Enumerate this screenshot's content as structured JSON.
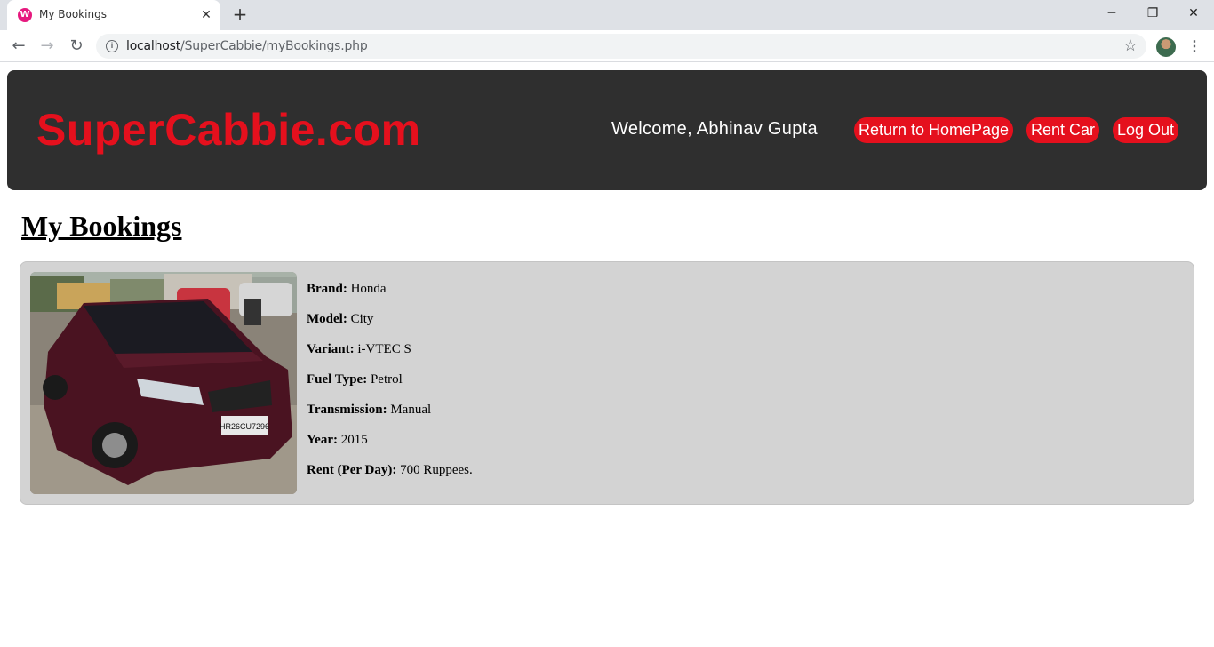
{
  "browser": {
    "tab_title": "My Bookings",
    "tab_favicon_letter": "W",
    "url_host": "localhost",
    "url_path": "/SuperCabbie/myBookings.php"
  },
  "header": {
    "logo": "SuperCabbie.com",
    "welcome": "Welcome, Abhinav Gupta",
    "nav": [
      {
        "label": "Return to HomePage"
      },
      {
        "label": "Rent Car"
      },
      {
        "label": "Log Out"
      }
    ]
  },
  "page": {
    "title": "My Bookings"
  },
  "booking": {
    "details": [
      {
        "label": "Brand:",
        "value": "Honda"
      },
      {
        "label": "Model:",
        "value": "City"
      },
      {
        "label": "Variant:",
        "value": "i-VTEC S"
      },
      {
        "label": "Fuel Type:",
        "value": "Petrol"
      },
      {
        "label": "Transmission:",
        "value": "Manual"
      },
      {
        "label": "Year:",
        "value": "2015"
      },
      {
        "label": "Rent (Per Day):",
        "value": "700 Ruppees."
      }
    ],
    "plate": "HR26CU7296"
  },
  "colors": {
    "brand_red": "#e5101d",
    "header_bg": "#2f2f2f",
    "card_bg": "#d3d3d3"
  }
}
